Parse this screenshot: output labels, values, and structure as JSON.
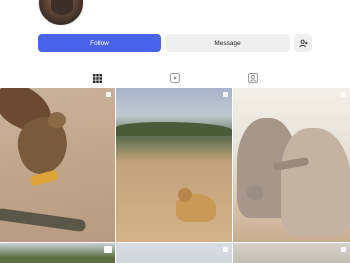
{
  "profile": {
    "follow_label": "Follow",
    "message_label": "Message",
    "more_icon": "add-person-icon"
  },
  "tabs": [
    {
      "icon": "grid-icon",
      "active": true
    },
    {
      "icon": "reels-icon",
      "active": false
    },
    {
      "icon": "tagged-icon",
      "active": false
    }
  ],
  "grid": {
    "posts": [
      {
        "subject": "eagle",
        "badge": "multi-photo-icon"
      },
      {
        "subject": "lion",
        "badge": "multi-photo-icon"
      },
      {
        "subject": "elephants",
        "badge": "multi-photo-icon"
      },
      {
        "subject": "landscape",
        "badge": "video-icon"
      },
      {
        "subject": "sky",
        "badge": "multi-photo-icon"
      },
      {
        "subject": "savanna",
        "badge": "multi-photo-icon"
      }
    ]
  },
  "colors": {
    "accent": "#4a63e9",
    "button_secondary": "#efefef",
    "text": "#262626"
  }
}
